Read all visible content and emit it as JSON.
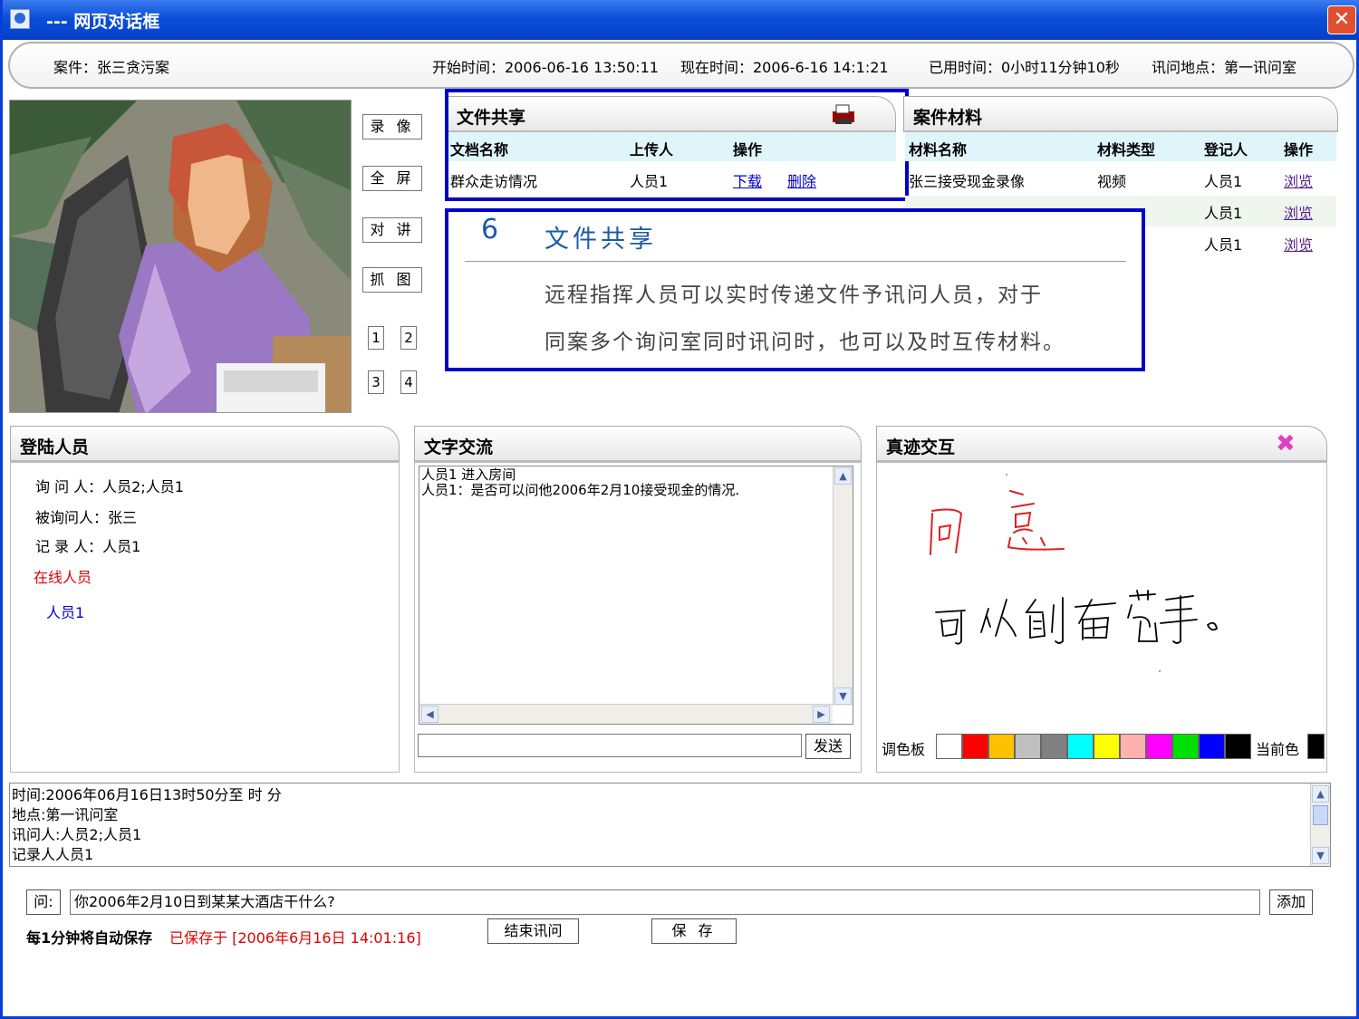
{
  "window": {
    "title": "--- 网页对话框",
    "close": "✕"
  },
  "info": {
    "case": "案件：张三贪污案",
    "start": "开始时间：2006-06-16 13:50:11",
    "now": "现在时间：2006-6-16 14:1:21",
    "elapsed": "已用时间：0小时11分钟10秒",
    "location": "讯问地点：第一讯问室"
  },
  "side_buttons": [
    "录 像",
    "全 屏",
    "对 讲",
    "抓 图"
  ],
  "channels": [
    "1",
    "2",
    "3",
    "4"
  ],
  "file_share": {
    "title": "文件共享",
    "columns": [
      "文档名称",
      "上传人",
      "操作"
    ],
    "rows": [
      {
        "name": "群众走访情况",
        "uploader": "人员1",
        "download": "下载",
        "delete": "删除"
      }
    ]
  },
  "case_material": {
    "title": "案件材料",
    "columns": [
      "材料名称",
      "材料类型",
      "登记人",
      "操作"
    ],
    "rows": [
      {
        "name": "张三接受现金录像",
        "type": "视频",
        "registrar": "人员1",
        "action": "浏览"
      },
      {
        "name": "",
        "type": "",
        "registrar": "人员1",
        "action": "浏览"
      },
      {
        "name": "",
        "type": "",
        "registrar": "人员1",
        "action": "浏览"
      }
    ]
  },
  "callout": {
    "number": "6",
    "title": "文件共享",
    "line1": "远程指挥人员可以实时传递文件予讯问人员，对于",
    "line2": "同案多个询问室同时讯问时，也可以及时互传材料。"
  },
  "login": {
    "title": "登陆人员",
    "interrogator": "询 问 人：人员2;人员1",
    "interrogee": "被询问人：张三",
    "recorder": "记 录 人：人员1",
    "online_label": "在线人员",
    "online_user": "人员1"
  },
  "chat": {
    "title": "文字交流",
    "lines": [
      "人员1 进入房间",
      "人员1：是否可以问他2006年2月10接受现金的情况."
    ],
    "send": "发送",
    "input_value": ""
  },
  "handwriting": {
    "title": "真迹交互",
    "palette_label": "调色板",
    "current_label": "当前色",
    "colors": [
      "#ffffff",
      "#ff0000",
      "#ffc000",
      "#c0c0c0",
      "#808080",
      "#00ffff",
      "#ffff00",
      "#ffb0b0",
      "#ff00ff",
      "#00e000",
      "#0000ff",
      "#000000"
    ],
    "current_color": "#000000"
  },
  "record": {
    "lines": [
      "时间:2006年06月16日13时50分至  时  分",
      "地点:第一讯问室",
      "讯问人:人员2;人员1",
      "记录人人员1"
    ]
  },
  "question": {
    "label": "问:",
    "value": "你2006年2月10日到某某大酒店干什么?",
    "add": "添加"
  },
  "footer": {
    "autosave": "每1分钟将自动保存",
    "saved": "已保存于 [2006年6月16日 14:01:16]",
    "end": "结束讯问",
    "save": "保 存"
  }
}
